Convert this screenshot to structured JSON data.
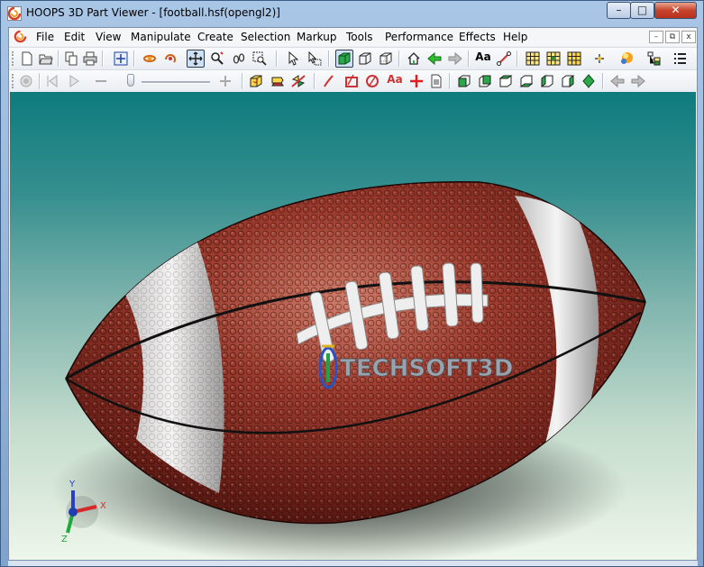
{
  "window": {
    "title": "HOOPS 3D Part Viewer - [football.hsf(opengl2)]",
    "app_icon": "hoops-logo-icon",
    "controls": {
      "minimize": "–",
      "maximize": "□",
      "close": "✕"
    }
  },
  "menubar": {
    "items": [
      {
        "label": "File"
      },
      {
        "label": "Edit"
      },
      {
        "label": "View"
      },
      {
        "label": "Manipulate"
      },
      {
        "label": "Create"
      },
      {
        "label": "Selection"
      },
      {
        "label": "Markup"
      },
      {
        "label": "Tools"
      },
      {
        "label": "Performance"
      },
      {
        "label": "Effects"
      },
      {
        "label": "Help"
      }
    ],
    "mdi_controls": {
      "minimize": "–",
      "restore": "⧉",
      "close": "x"
    }
  },
  "toolbar1": {
    "buttons": [
      "new-file-icon",
      "open-file-icon",
      "copy-icon",
      "print-icon",
      "fit-world-icon",
      "orbit-icon",
      "turntable-icon",
      "pan-icon",
      "zoom-icon",
      "walk-icon",
      "zoom-window-icon",
      "select-icon",
      "area-select-icon",
      "shaded-icon",
      "wireframe-icon",
      "hidden-line-icon",
      "home-view-icon",
      "back-arrow-icon",
      "forward-arrow-icon",
      "annotate-text-icon",
      "measure-icon",
      "grid-icon",
      "grid-alt-icon",
      "grid-yellow-icon",
      "snap-point-icon",
      "spot-light-icon",
      "tree-icon",
      "list-icon"
    ],
    "text_button_label": "Aa"
  },
  "toolbar2": {
    "slider_value": 0,
    "text_button_label": "Aa",
    "buttons": [
      "record-icon",
      "skip-start-icon",
      "play-icon",
      "minus-icon",
      "plus-icon",
      "iso-view-icon",
      "sphere-icon",
      "section-icon",
      "freehand-icon",
      "markup-rect-icon",
      "markup-circle-icon",
      "markup-text-icon",
      "markup-plus-icon",
      "markup-doc-icon",
      "view-front-icon",
      "view-back-icon",
      "view-top-icon",
      "view-bottom-icon",
      "view-left-icon",
      "view-right-icon",
      "view-iso-icon",
      "prev-view-icon",
      "next-view-icon"
    ]
  },
  "viewport": {
    "model": "football",
    "logo_text": "TECHSOFT3D",
    "axis_labels": {
      "x": "X",
      "y": "Y",
      "z": "Z"
    },
    "colors": {
      "background_top": "#0e7b7d",
      "background_bottom": "#eef6ea",
      "leather": "#8a3026",
      "stripe": "#f2f2f2"
    }
  }
}
